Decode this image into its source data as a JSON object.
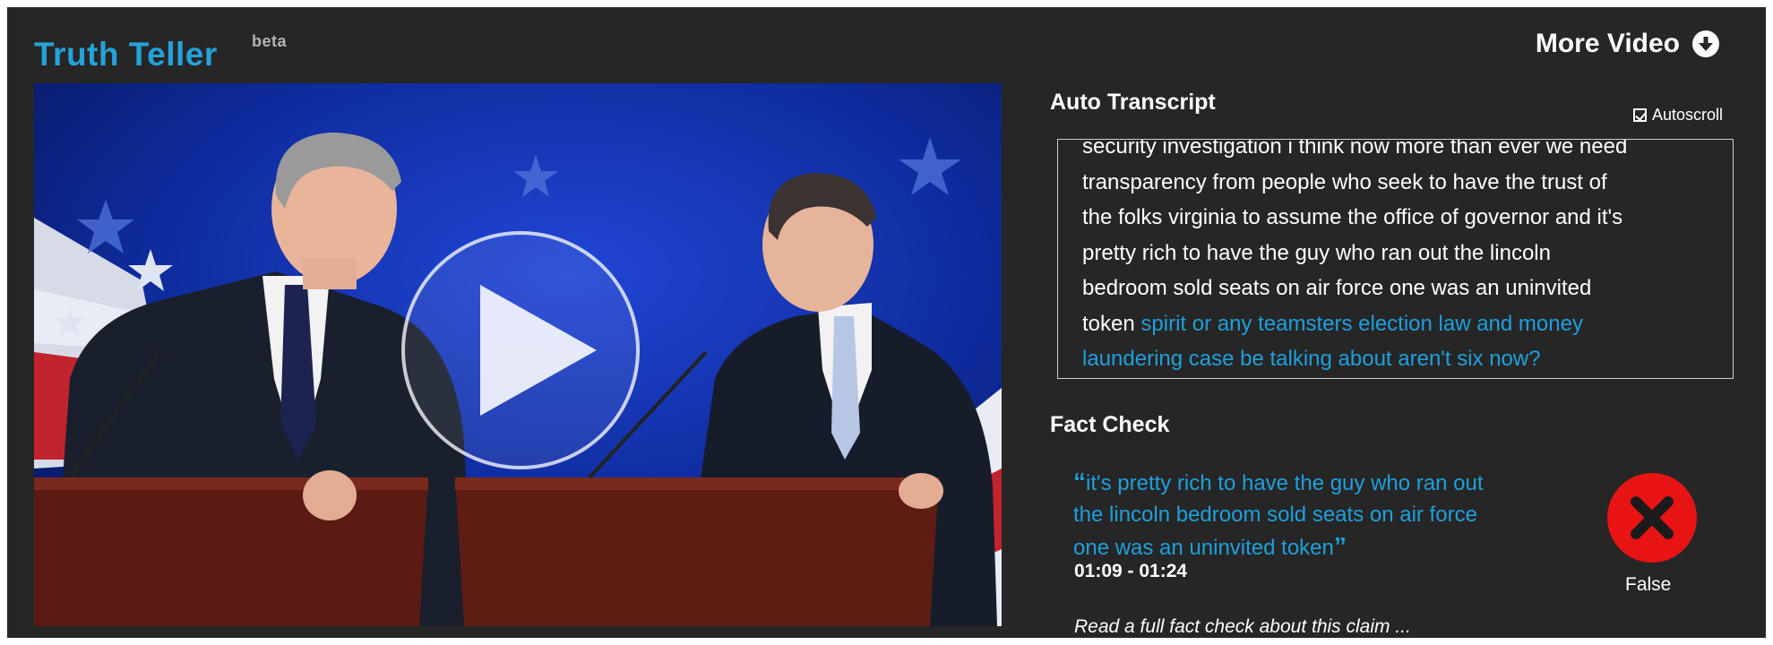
{
  "app": {
    "title": "Truth Teller",
    "badge": "beta",
    "brand_color": "#24a2da"
  },
  "header": {
    "more_video_label": "More Video",
    "more_video_icon": "arrow-down-circle-icon"
  },
  "video": {
    "play_icon": "play-icon"
  },
  "transcript": {
    "title": "Auto Transcript",
    "autoscroll_label": "Autoscroll",
    "autoscroll_checked": true,
    "lines": [
      "security investigation i think now more than ever we need",
      "transparency from people who seek to have the trust of",
      "the folks virginia to assume the office of governor and it's",
      "pretty rich to have the guy who ran out the lincoln",
      "bedroom sold seats on air force one was an uninvited"
    ],
    "current_text": "token",
    "highlight_text_1": "spirit or any teamsters election law and money",
    "highlight_text_2": "laundering case be talking about aren't six now?",
    "highlight_color": "#1ea0dc"
  },
  "fact_check": {
    "title": "Fact Check",
    "open_quote": "“",
    "close_quote": "”",
    "quote_lines": [
      "it's pretty rich to have the guy who ran out",
      "the lincoln bedroom sold seats on air force",
      "one was an uninvited token"
    ],
    "time_range": "01:09 - 01:24",
    "verdict": "False",
    "verdict_color": "#e81414",
    "verdict_icon": "x-icon",
    "read_more": "Read a full fact check about this claim ..."
  }
}
